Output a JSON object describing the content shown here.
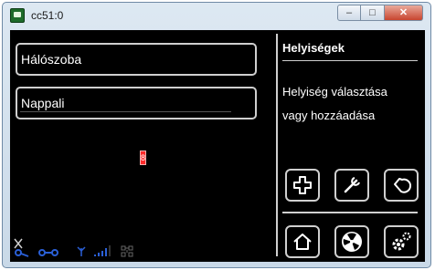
{
  "window": {
    "title": "cc51:0",
    "buttons": {
      "minimize": "–",
      "maximize": "□",
      "close": "✕"
    }
  },
  "rooms": [
    {
      "label": "Hálószoba"
    },
    {
      "label": "Nappali"
    }
  ],
  "marker": {
    "text": "8"
  },
  "sidebar": {
    "title": "Helyiségek",
    "description_line1": "Helyiség választása",
    "description_line2": "vagy hozzáadása",
    "actions": [
      {
        "icon": "plus-icon"
      },
      {
        "icon": "wrench-icon"
      },
      {
        "icon": "back-icon"
      },
      {
        "icon": "home-icon"
      },
      {
        "icon": "fan-icon"
      },
      {
        "icon": "settings-icon"
      }
    ]
  },
  "status_bar": {
    "icons": [
      "cross-icon",
      "key-icon",
      "link-icon",
      "antenna-icon",
      "signal-bars-icon",
      "network-icon"
    ],
    "signal_level": 4,
    "signal_max": 5
  },
  "colors": {
    "background": "#000000",
    "foreground": "#ffffff",
    "border": "#cfcfcf",
    "accent": "#2a5fd6",
    "marker": "#ff2a2a"
  }
}
